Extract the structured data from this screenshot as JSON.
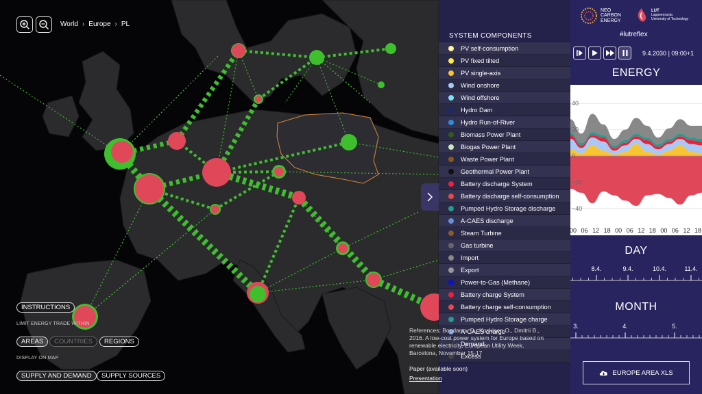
{
  "breadcrumb": [
    "World",
    "Europe",
    "PL"
  ],
  "controls": {
    "instructions": "INSTRUCTIONS",
    "limit_label": "LIMIT ENERGY TRADE WITHIN",
    "areas": "AREAS",
    "countries": "COUNTRIES",
    "regions": "REGIONS",
    "display_label": "DISPLAY ON MAP",
    "supply_demand": "SUPPLY AND DEMAND",
    "supply_sources": "SUPPLY SOURCES"
  },
  "references": {
    "text": "References: Bogdanov D., Koskinen O., Dmitrii B., 2016. A low-cost power system for Europe based on renewable electricity, European Utility Week, Barcelona, November 15-17",
    "paper": "Paper (available soon)",
    "presentation": "Presentation"
  },
  "components": {
    "title": "SYSTEM COMPONENTS",
    "items": [
      {
        "label": "PV self-consumption",
        "color": "#fff3a0"
      },
      {
        "label": "PV fixed tilted",
        "color": "#ffe94a"
      },
      {
        "label": "PV single-axis",
        "color": "#f7c531"
      },
      {
        "label": "Wind onshore",
        "color": "#a9c8f5"
      },
      {
        "label": "Wind offshore",
        "color": "#7fe0f2"
      },
      {
        "label": "Hydro Dam",
        "color": "#1d2a6b"
      },
      {
        "label": "Hydro Run-of-River",
        "color": "#2b8fd6"
      },
      {
        "label": "Biomass Power Plant",
        "color": "#2e5b22"
      },
      {
        "label": "Biogas Power Plant",
        "color": "#c9e9b8"
      },
      {
        "label": "Waste Power Plant",
        "color": "#8a5a14"
      },
      {
        "label": "Geothermal Power Plant",
        "color": "#111111"
      },
      {
        "label": "Battery discharge System",
        "color": "#e8243c"
      },
      {
        "label": "Battery discharge self-consumption",
        "color": "#e5484d"
      },
      {
        "label": "Pumped Hydro Storage discharge",
        "color": "#2a9a8f"
      },
      {
        "label": "A-CAES discharge",
        "color": "#6a8fd8"
      },
      {
        "label": "Steam Turbine",
        "color": "#8a5a2a"
      },
      {
        "label": "Gas turbine",
        "color": "#666666"
      },
      {
        "label": "Import",
        "color": "#888888"
      },
      {
        "label": "Export",
        "color": "#999999"
      },
      {
        "label": "Power-to-Gas (Methane)",
        "color": "#1010d0"
      },
      {
        "label": "Battery charge System",
        "color": "#e8243c"
      },
      {
        "label": "Battery charge self-consumption",
        "color": "#e5484d"
      },
      {
        "label": "Pumped Hydro Storage charge",
        "color": "#2a9a8f"
      },
      {
        "label": "A-CAES charge",
        "color": "#6a8fd8"
      },
      {
        "label": "Demand",
        "color": "#333333"
      },
      {
        "label": "Excess",
        "color": "#444444"
      }
    ]
  },
  "brand": {
    "neo_line1": "NEO",
    "neo_line2": "CARBON",
    "neo_line3": "ENERGY",
    "lut_line1": "LUT",
    "lut_line2": "Lappeenranta",
    "lut_line3": "University of Technology",
    "hashtag": "#lutreflex"
  },
  "playback": {
    "date": "9.4.2030",
    "time": "09:00+1"
  },
  "sections": {
    "energy": "ENERGY",
    "day": "DAY",
    "month": "MONTH"
  },
  "chart_data": {
    "type": "area",
    "title": "ENERGY",
    "ylim": [
      -50,
      50
    ],
    "yticks": [
      40,
      20,
      0,
      -20,
      -40
    ],
    "xticks": [
      "00",
      "06",
      "12",
      "18",
      "00",
      "06",
      "12",
      "18",
      "00",
      "06",
      "12",
      "18"
    ],
    "x": [
      0,
      6,
      12,
      18,
      24,
      30,
      36,
      42,
      48,
      54,
      60,
      66,
      72
    ],
    "series": [
      {
        "color": "#f7c531",
        "values": [
          5,
          2,
          8,
          4,
          1,
          3,
          9,
          3,
          1,
          4,
          8,
          3,
          2
        ]
      },
      {
        "color": "#a9c8f5",
        "values": [
          8,
          4,
          6,
          7,
          3,
          5,
          4,
          6,
          4,
          5,
          5,
          6,
          6
        ]
      },
      {
        "color": "#e8243c",
        "values": [
          3,
          2,
          2,
          3,
          2,
          2,
          2,
          3,
          2,
          2,
          2,
          3,
          3
        ]
      },
      {
        "color": "#2a9a8f",
        "values": [
          2,
          2,
          2,
          2,
          2,
          2,
          2,
          2,
          2,
          2,
          2,
          2,
          2
        ]
      },
      {
        "color": "#888888",
        "values": [
          10,
          7,
          14,
          8,
          5,
          8,
          12,
          9,
          5,
          8,
          11,
          9,
          10
        ]
      },
      {
        "color": "#e0485a",
        "values": [
          -25,
          -28,
          -36,
          -27,
          -30,
          -34,
          -38,
          -30,
          -29,
          -32,
          -37,
          -30,
          -28
        ]
      }
    ]
  },
  "day_axis": {
    "labels": [
      "8.4.",
      "9.4.",
      "10.4.",
      "11.4."
    ]
  },
  "month_axis": {
    "labels": [
      "3.",
      "4.",
      "5."
    ]
  },
  "export_button": "EUROPE AREA XLS"
}
